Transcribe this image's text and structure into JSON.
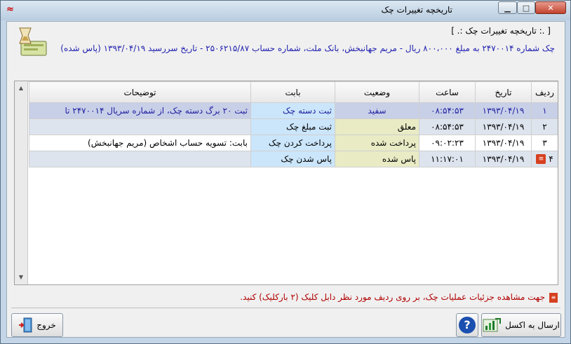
{
  "window": {
    "title": "تاریخچه تغییرات چک"
  },
  "group": {
    "title": "[ .: تاریخچه تغییرات چک :. ]"
  },
  "check_info": "چک شماره ۲۴۷۰۰۱۴ به مبلغ ۸۰۰،۰۰۰ ریال - مریم جهانبخش، بانک ملت، شماره حساب ۲۵۰۶۲۱۵/۸۷ - تاریخ سررسید ۱۳۹۳/۰۴/۱۹ (پاس شده)",
  "table": {
    "headers": {
      "idx": "ردیف",
      "date": "تاریخ",
      "time": "ساعت",
      "status": "وضعیت",
      "babat": "بابت",
      "desc": "توضیحات"
    },
    "rows": [
      {
        "idx": "۱",
        "date": "۱۳۹۳/۰۴/۱۹",
        "time": "۰۸:۵۴:۵۳",
        "status": "سفید",
        "babat": "ثبت دسته چک",
        "desc": "ثبت ۲۰ برگ دسته چک، از شماره سریال ۲۴۷۰۰۱۴ تا"
      },
      {
        "idx": "۲",
        "date": "۱۳۹۳/۰۴/۱۹",
        "time": "۰۸:۵۴:۵۳",
        "status": "معلق",
        "babat": "ثبت مبلغ چک",
        "desc": ""
      },
      {
        "idx": "۳",
        "date": "۱۳۹۳/۰۴/۱۹",
        "time": "۰۹:۰۲:۲۳",
        "status": "پرداخت شده",
        "babat": "پرداخت کردن چک",
        "desc": "بابت: تسویه حساب اشخاص (مریم جهانبخش)"
      },
      {
        "idx": "۴",
        "date": "۱۳۹۳/۰۴/۱۹",
        "time": "۱۱:۱۷:۰۱",
        "status": "پاس شده",
        "babat": "پاس شدن چک",
        "desc": ""
      }
    ]
  },
  "hint": "جهت مشاهده جزئیات عملیات چک، بر روی ردیف مورد نظر دابل کلیک (۲ بارکلیک) کنید.",
  "buttons": {
    "excel": "ارسال به اکسل",
    "help": "?",
    "exit": "خروج"
  },
  "colors": {
    "accent_blue": "#2020a0",
    "hint_red": "#b00000",
    "excel_green": "#1e7a2a"
  }
}
